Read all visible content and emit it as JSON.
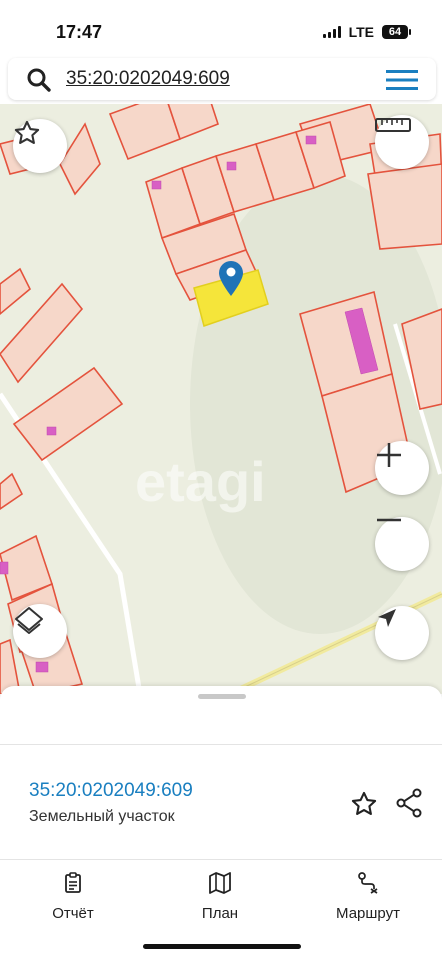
{
  "status_bar": {
    "time": "17:47",
    "network": "LTE",
    "battery": "64"
  },
  "search": {
    "query": "35:20:0202049:609",
    "search_icon": "search-icon",
    "menu_icon": "hamburger-menu-icon"
  },
  "map": {
    "watermark": "etagi",
    "colors": {
      "background": "#eceee0",
      "parcel_fill": "#f6d7c9",
      "parcel_border": "#e4533d",
      "building": "#d85fc4",
      "selected_parcel": "#f5e53a",
      "pin": "#1f73b7"
    },
    "controls": {
      "favorite_icon": "star-icon",
      "ruler_icon": "ruler-icon",
      "zoom_in_icon": "plus-icon",
      "zoom_out_icon": "minus-icon",
      "layers_icon": "layers-icon",
      "locate_icon": "navigation-arrow-icon"
    }
  },
  "sheet": {
    "cadastral_number": "35:20:0202049:609",
    "object_type": "Земельный участок",
    "star_icon": "star-outline-icon",
    "share_icon": "share-icon"
  },
  "tabs": [
    {
      "label": "Отчёт",
      "icon": "report-icon"
    },
    {
      "label": "План",
      "icon": "map-icon"
    },
    {
      "label": "Маршрут",
      "icon": "route-icon"
    }
  ]
}
